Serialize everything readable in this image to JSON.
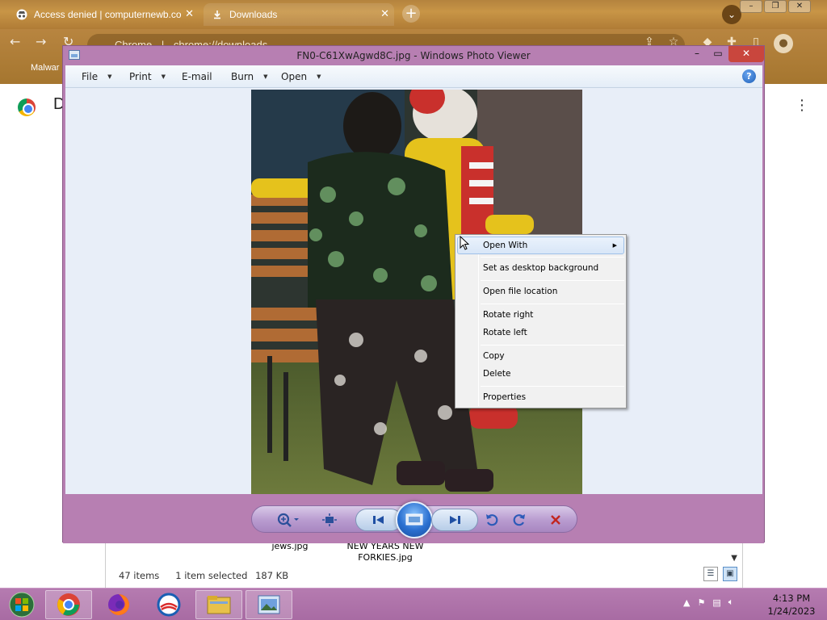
{
  "browser": {
    "tabs": [
      {
        "title": "Access denied | computernewb.co",
        "icon": "incognito-icon"
      },
      {
        "title": "Downloads",
        "icon": "download-icon"
      }
    ],
    "omnibox": {
      "label": "Chrome",
      "url": "chrome://downloads"
    },
    "bookmark": "Malwar",
    "page_heading_initial": "D"
  },
  "photo_viewer": {
    "title": "FN0-C61XwAgwd8C.jpg - Windows Photo Viewer",
    "menu": [
      "File",
      "Print",
      "E-mail",
      "Burn",
      "Open"
    ],
    "help": "?"
  },
  "context_menu": {
    "items": [
      {
        "label": "Open With",
        "highlighted": true,
        "submenu": true
      },
      {
        "label": "Set as desktop background"
      },
      {
        "label": "Open file location"
      },
      {
        "label": "Rotate right"
      },
      {
        "label": "Rotate left"
      },
      {
        "label": "Copy"
      },
      {
        "label": "Delete"
      },
      {
        "label": "Properties"
      }
    ]
  },
  "explorer": {
    "files": [
      "jews.jpg",
      "NEW YEARS NEW FORKIES.jpg"
    ],
    "status": {
      "count": "47 items",
      "selected": "1 item selected",
      "size": "187 KB"
    }
  },
  "taskbar": {
    "apps": [
      "start-orb-icon",
      "chrome-icon",
      "firefox-icon",
      "edge-icon",
      "file-explorer-icon",
      "photo-viewer-icon"
    ],
    "clock": {
      "time": "4:13 PM",
      "date": "1/24/2023"
    }
  }
}
